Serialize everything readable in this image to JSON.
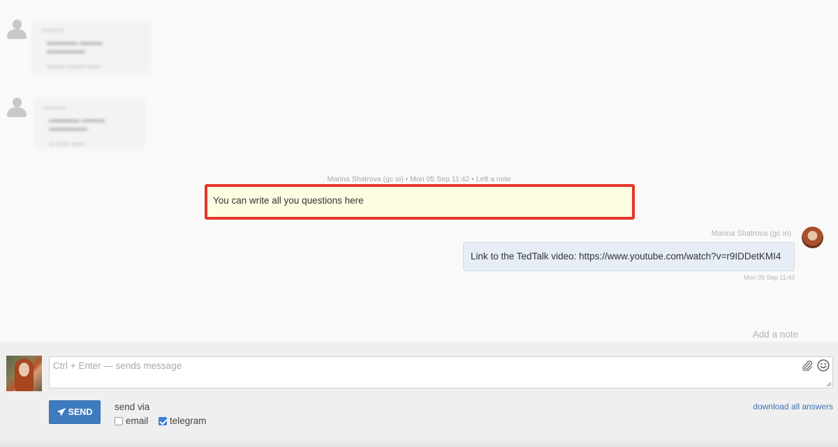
{
  "note": {
    "meta": "Marina Shatrova (gc io) • Mon 05 Sep 11:42 • Left a note",
    "text": "You can write all you questions here"
  },
  "message": {
    "author": "Marina Shatrova (gc io)",
    "text": "Link to the TedTalk video: https://www.youtube.com/watch?v=r9IDDetKMI4",
    "time": "Mon 05 Sep 11:43"
  },
  "add_note_label": "Add a note",
  "composer": {
    "placeholder": "Ctrl + Enter — sends message",
    "send_label": "SEND",
    "send_via_label": "send via",
    "options": [
      {
        "label": "email",
        "checked": false
      },
      {
        "label": "telegram",
        "checked": true
      }
    ],
    "download_label": "download all answers"
  },
  "colors": {
    "highlight_border": "#e53528",
    "note_background": "#fdfde2",
    "bubble_background": "#e6edf4",
    "send_button": "#3f7bbf",
    "link": "#3d73b0"
  }
}
